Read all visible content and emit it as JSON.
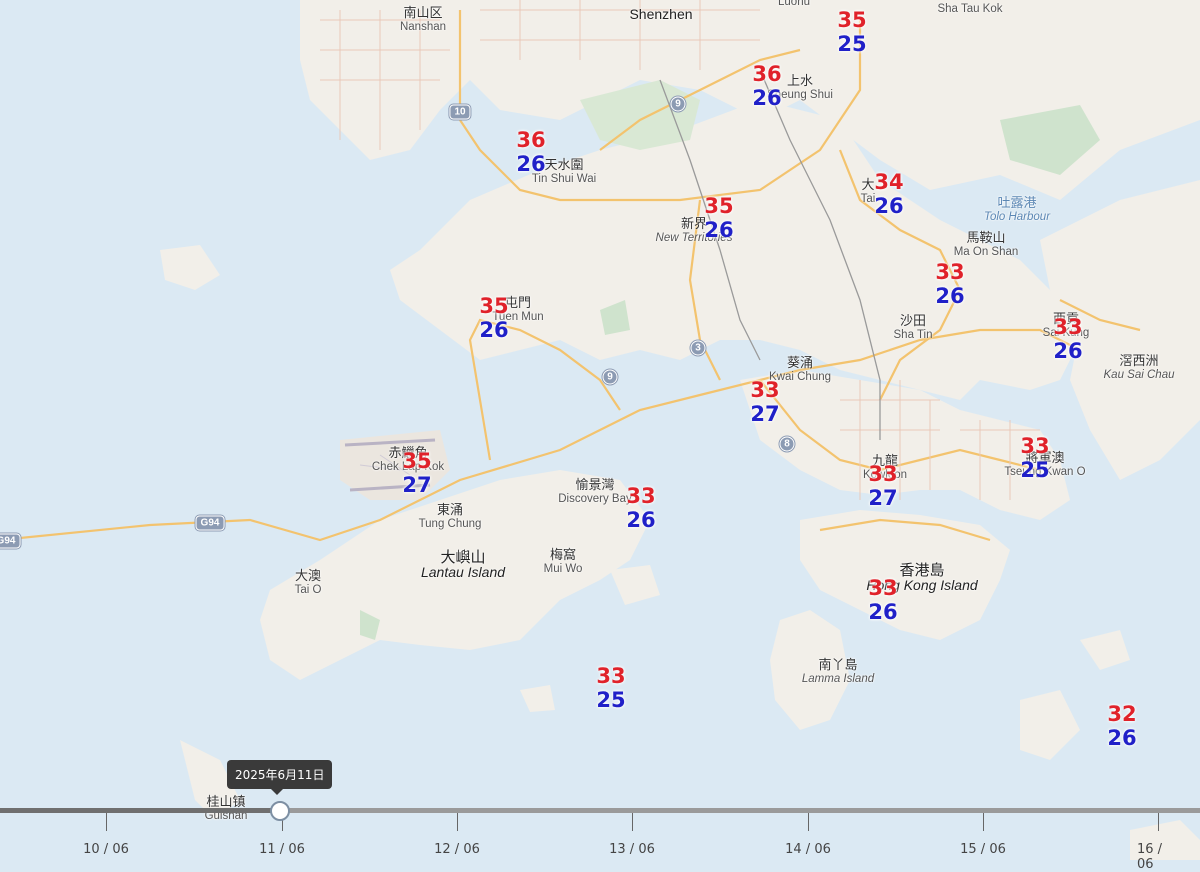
{
  "colors": {
    "water": "#dbe9f3",
    "land": "#f2efe9",
    "park": "#cfe3cd",
    "road_major": "#f3c36e",
    "temp_high": "#e0222a",
    "temp_low": "#2020c8"
  },
  "labels": {
    "nanshan": {
      "cn": "南山区",
      "en": "Nanshan"
    },
    "shenzhen": {
      "en": "Shenzhen"
    },
    "luohu": {
      "en": "Luohu"
    },
    "sha_tau_kok": {
      "en": "Sha Tau Kok"
    },
    "sheung_shui": {
      "cn": "上水",
      "en": "Sheung Shui"
    },
    "tin_shui_wai": {
      "cn": "天水圍",
      "en": "Tin Shui Wai"
    },
    "tai_po": {
      "cn": "大",
      "en": "Tai"
    },
    "tolo_harbour": {
      "cn": "吐露港",
      "en": "Tolo Harbour"
    },
    "new_territories": {
      "cn": "新界",
      "en": "New Territories"
    },
    "ma_on_shan": {
      "cn": "馬鞍山",
      "en": "Ma On Shan"
    },
    "tuen_mun": {
      "cn": "屯門",
      "en": "Tuen Mun"
    },
    "sha_tin": {
      "cn": "沙田",
      "en": "Sha Tin"
    },
    "sai_kung": {
      "cn": "西貢",
      "en": "Sai Kung"
    },
    "kau_sai_chau": {
      "cn": "滘西洲",
      "en": "Kau Sai Chau"
    },
    "kwai_chung": {
      "cn": "葵涌",
      "en": "Kwai Chung"
    },
    "chek_lap_kok": {
      "cn": "赤鱲角",
      "en": "Chek Lap Kok"
    },
    "kowloon": {
      "cn": "九龍",
      "en": "Kowloon"
    },
    "tseung_kwan_o": {
      "cn": "將軍澳",
      "en": "Tseung Kwan O"
    },
    "discovery_bay": {
      "cn": "愉景灣",
      "en": "Discovery Bay"
    },
    "tung_chung": {
      "cn": "東涌",
      "en": "Tung Chung"
    },
    "lantau": {
      "cn": "大嶼山",
      "en": "Lantau Island"
    },
    "mui_wo": {
      "cn": "梅窩",
      "en": "Mui Wo"
    },
    "tai_o": {
      "cn": "大澳",
      "en": "Tai O"
    },
    "hk_island": {
      "cn": "香港島",
      "en": "Hong Kong Island"
    },
    "lamma": {
      "cn": "南丫島",
      "en": "Lamma Island"
    },
    "guishan": {
      "cn": "桂山镇",
      "en": "Guishan"
    }
  },
  "shields": {
    "r10": "10",
    "r9a": "9",
    "r3": "3",
    "r9b": "9",
    "r8": "8",
    "g94": "G94",
    "g94b": "G94"
  },
  "temps": [
    {
      "id": "luohu",
      "high": "35",
      "low": "25"
    },
    {
      "id": "sheung-shui",
      "high": "36",
      "low": "26"
    },
    {
      "id": "tin-shui-wai",
      "high": "36",
      "low": "26"
    },
    {
      "id": "tai-po",
      "high": "34",
      "low": "26"
    },
    {
      "id": "new-territories",
      "high": "35",
      "low": "26"
    },
    {
      "id": "ma-on-shan",
      "high": "33",
      "low": "26"
    },
    {
      "id": "tuen-mun",
      "high": "35",
      "low": "26"
    },
    {
      "id": "sai-kung",
      "high": "33",
      "low": "26"
    },
    {
      "id": "kwai-chung",
      "high": "33",
      "low": "27"
    },
    {
      "id": "chek-lap-kok",
      "high": "35",
      "low": "27"
    },
    {
      "id": "tseung-kwan-o",
      "high": "33",
      "low": "25"
    },
    {
      "id": "kowloon",
      "high": "33",
      "low": "27"
    },
    {
      "id": "discovery-bay",
      "high": "33",
      "low": "26"
    },
    {
      "id": "hong-kong-island",
      "high": "33",
      "low": "26"
    },
    {
      "id": "south-waters",
      "high": "33",
      "low": "25"
    },
    {
      "id": "east-waters",
      "high": "32",
      "low": "26"
    }
  ],
  "timeline": {
    "tooltip": "2025年6月11日",
    "ticks": [
      "10 / 06",
      "11 / 06",
      "12 / 06",
      "13 / 06",
      "14 / 06",
      "15 / 06",
      "16 / 06"
    ]
  }
}
